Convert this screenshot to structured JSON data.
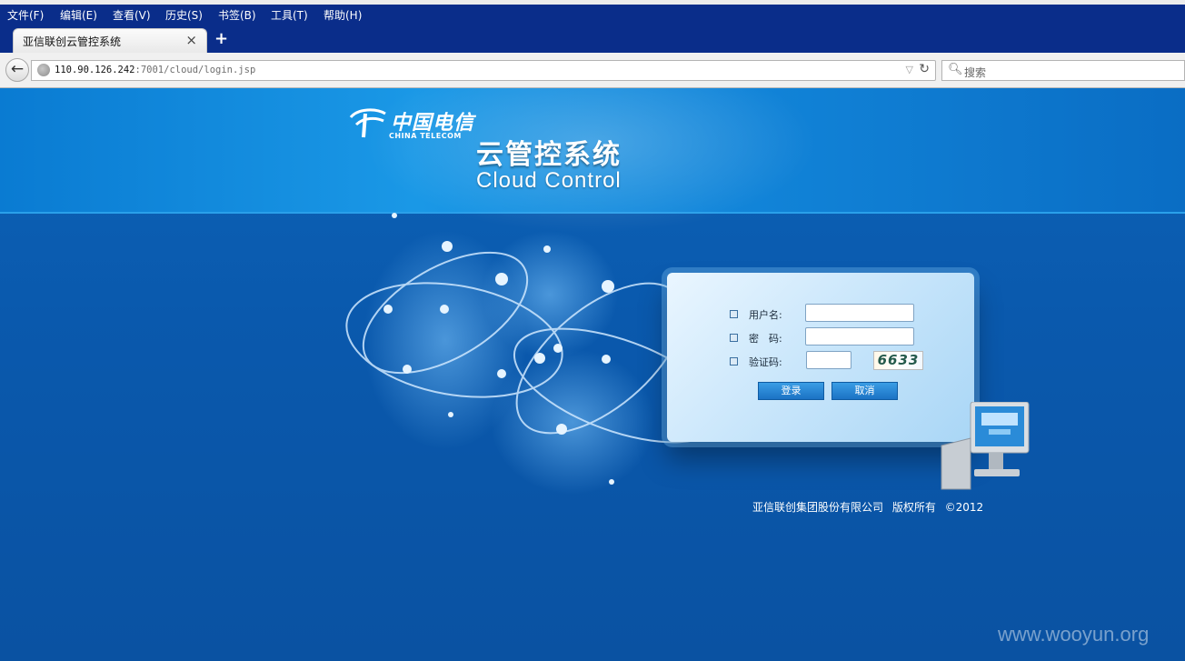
{
  "browser": {
    "menu": [
      "文件(F)",
      "编辑(E)",
      "查看(V)",
      "历史(S)",
      "书签(B)",
      "工具(T)",
      "帮助(H)"
    ],
    "tab_title": "亚信联创云管控系统",
    "tab_close": "×",
    "new_tab": "+",
    "url_host": "110.90.126.242",
    "url_path": ":7001/cloud/login.jsp",
    "search_placeholder": "搜索"
  },
  "header": {
    "logo_cn": "中国电信",
    "logo_en": "CHINA TELECOM",
    "title": "云管控系统",
    "subtitle": "Cloud Control"
  },
  "login": {
    "username_label": "用户名:",
    "password_label": "密　码:",
    "captcha_label": "验证码:",
    "captcha_value": "6633",
    "login_button": "登录",
    "cancel_button": "取消"
  },
  "footer": {
    "copyright": "亚信联创集团股份有限公司 版权所有 ©2012"
  },
  "watermark": "www.wooyun.org",
  "colors": {
    "menubar": "#0a2d8a",
    "page_bg": "#0b55a6",
    "header_band": "#1a98e6",
    "button": "#1b72c4"
  }
}
